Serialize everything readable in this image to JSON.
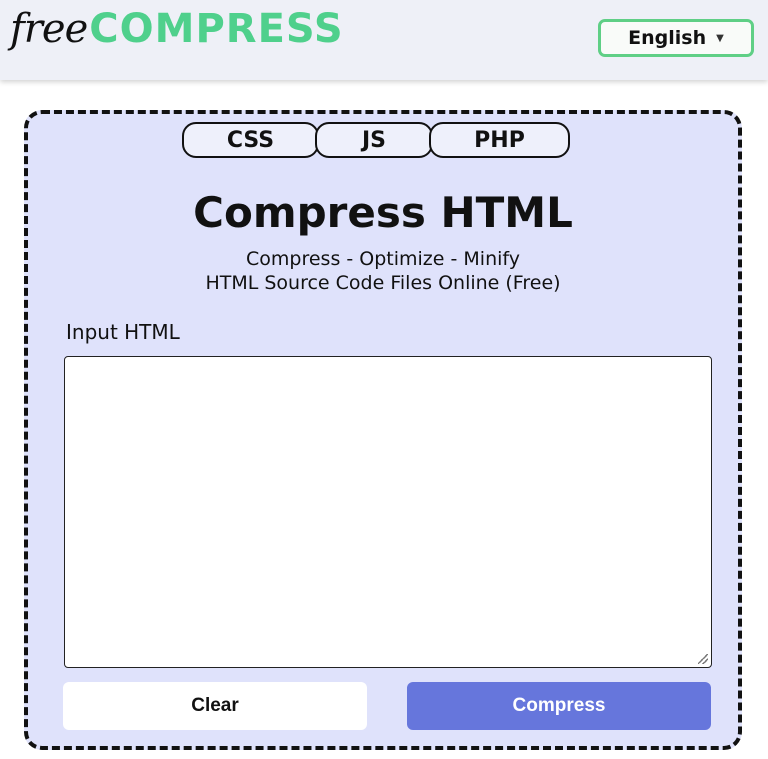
{
  "header": {
    "logo_free": "free",
    "logo_compress": "COMPRESS",
    "language": "English"
  },
  "tabs": [
    {
      "label": "CSS"
    },
    {
      "label": "JS"
    },
    {
      "label": "PHP"
    }
  ],
  "main": {
    "title": "Compress HTML",
    "subtitle_line1": "Compress - Optimize - Minify",
    "subtitle_line2": "HTML Source Code Files Online (Free)",
    "input_label": "Input HTML",
    "input_value": "",
    "clear_label": "Clear",
    "compress_label": "Compress"
  },
  "colors": {
    "brand_green": "#4fd08c",
    "card_bg": "#dfe2fb",
    "primary_button": "#6676dc"
  }
}
